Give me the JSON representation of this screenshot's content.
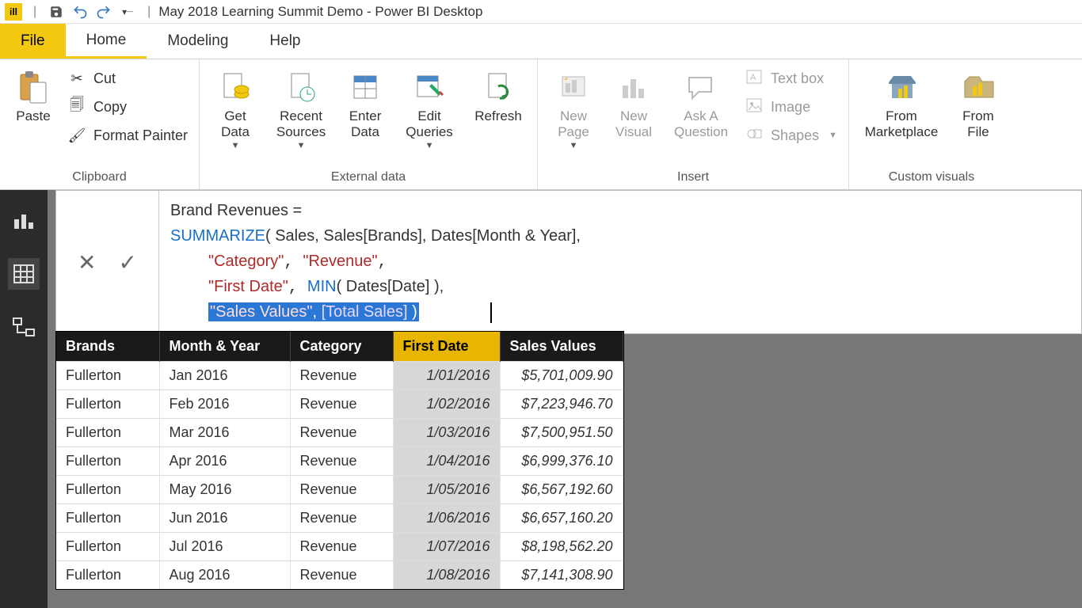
{
  "titlebar": {
    "app_icon_text": "ill",
    "window_title": "May 2018 Learning Summit Demo - Power BI Desktop"
  },
  "tabs": {
    "file": "File",
    "home": "Home",
    "modeling": "Modeling",
    "help": "Help"
  },
  "ribbon": {
    "clipboard": {
      "label": "Clipboard",
      "paste": "Paste",
      "cut": "Cut",
      "copy": "Copy",
      "format_painter": "Format Painter"
    },
    "external": {
      "label": "External data",
      "get_data": "Get\nData",
      "recent_sources": "Recent\nSources",
      "enter_data": "Enter\nData",
      "edit_queries": "Edit\nQueries",
      "refresh": "Refresh"
    },
    "insert": {
      "label": "Insert",
      "new_page": "New\nPage",
      "new_visual": "New\nVisual",
      "ask_question": "Ask A\nQuestion",
      "text_box": "Text box",
      "image": "Image",
      "shapes": "Shapes"
    },
    "custom": {
      "label": "Custom visuals",
      "from_marketplace": "From\nMarketplace",
      "from_file": "From\nFile"
    }
  },
  "formula": {
    "line1_a": "Brand Revenues =",
    "line2_func": "SUMMARIZE",
    "line2_rest": "( Sales, Sales[Brands], Dates[Month & Year],",
    "line3_s1": "\"Category\"",
    "line3_s2": "\"Revenue\"",
    "line4_s1": "\"First Date\"",
    "line4_func": "MIN",
    "line4_rest": "( Dates[Date] ),",
    "line5_s1": "\"Sales Values\"",
    "line5_meas": "[Total Sales]"
  },
  "table": {
    "headers": [
      "Brands",
      "Month & Year",
      "Category",
      "First Date",
      "Sales Values"
    ],
    "sorted_col": 3,
    "rows": [
      [
        "Fullerton",
        "Jan 2016",
        "Revenue",
        "1/01/2016",
        "$5,701,009.90"
      ],
      [
        "Fullerton",
        "Feb 2016",
        "Revenue",
        "1/02/2016",
        "$7,223,946.70"
      ],
      [
        "Fullerton",
        "Mar 2016",
        "Revenue",
        "1/03/2016",
        "$7,500,951.50"
      ],
      [
        "Fullerton",
        "Apr 2016",
        "Revenue",
        "1/04/2016",
        "$6,999,376.10"
      ],
      [
        "Fullerton",
        "May 2016",
        "Revenue",
        "1/05/2016",
        "$6,567,192.60"
      ],
      [
        "Fullerton",
        "Jun 2016",
        "Revenue",
        "1/06/2016",
        "$6,657,160.20"
      ],
      [
        "Fullerton",
        "Jul 2016",
        "Revenue",
        "1/07/2016",
        "$8,198,562.20"
      ],
      [
        "Fullerton",
        "Aug 2016",
        "Revenue",
        "1/08/2016",
        "$7,141,308.90"
      ]
    ]
  }
}
